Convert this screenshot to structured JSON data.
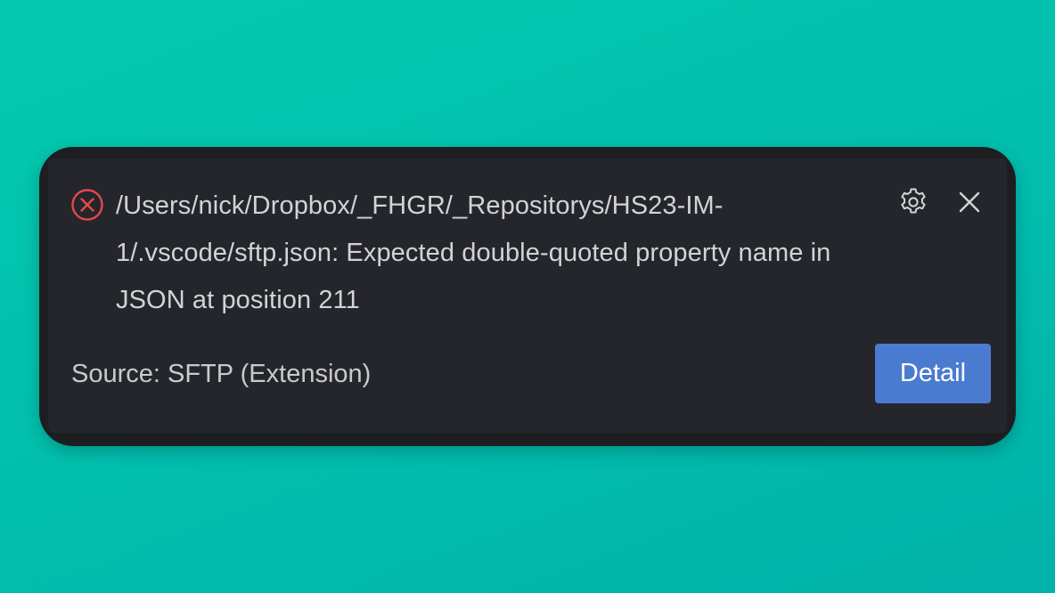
{
  "notification": {
    "severity": "error",
    "icon": "error-circle-icon",
    "message": "/Users/nick/Dropbox/_FHGR/_Repositorys/HS23-IM-1/.vscode/sftp.json: Expected double-quoted property name in JSON at position 211",
    "source_label": "Source: SFTP (Extension)",
    "actions": {
      "settings_icon": "gear-icon",
      "close_icon": "close-icon",
      "detail_label": "Detail"
    }
  },
  "colors": {
    "background_start": "#04c9ae",
    "background_end": "#00b2aa",
    "toast_background": "#25262c",
    "toast_frame": "#1d1e22",
    "text": "#d2d3d6",
    "error": "#e5484d",
    "accent": "#4b7bd0"
  }
}
